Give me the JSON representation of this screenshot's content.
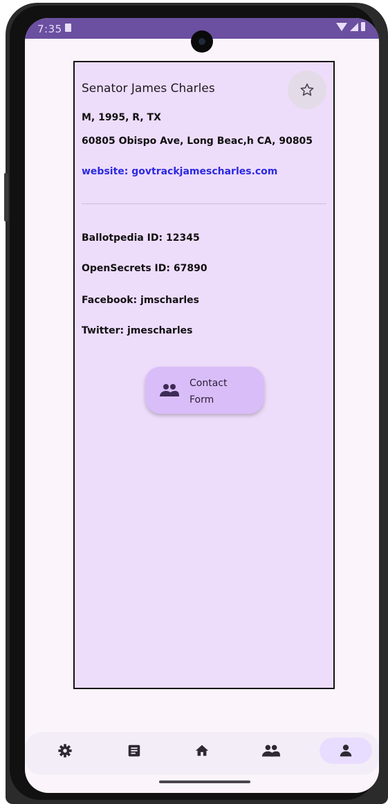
{
  "status_bar": {
    "time": "7:35",
    "icons": [
      "sim-card-icon",
      "wifi-icon",
      "signal-icon",
      "battery-icon"
    ]
  },
  "profile": {
    "name": "Senator James Charles",
    "favorite_icon": "star-outline-icon",
    "details": "M, 1995, R, TX",
    "address": "60805 Obispo Ave, Long Beac,h CA, 90805",
    "website": "website: govtrackjamescharles.com",
    "ballotpedia": "Ballotpedia ID: 12345",
    "opensecrets": "OpenSecrets ID: 67890",
    "facebook": "Facebook: jmscharles",
    "twitter": "Twitter: jmescharles"
  },
  "contact_button": {
    "label": "Contact Form",
    "icon": "group-icon"
  },
  "bottom_nav": {
    "items": [
      {
        "icon": "settings-icon",
        "active": false
      },
      {
        "icon": "article-icon",
        "active": false
      },
      {
        "icon": "home-icon",
        "active": false
      },
      {
        "icon": "group-icon",
        "active": false
      },
      {
        "icon": "person-icon",
        "active": true
      }
    ]
  },
  "colors": {
    "status_bar": "#6b4fa0",
    "card_background": "#eedcfb",
    "button_background": "#d9bdf8",
    "link": "#2a2ae0",
    "active_nav_pill": "#e9ddff"
  }
}
